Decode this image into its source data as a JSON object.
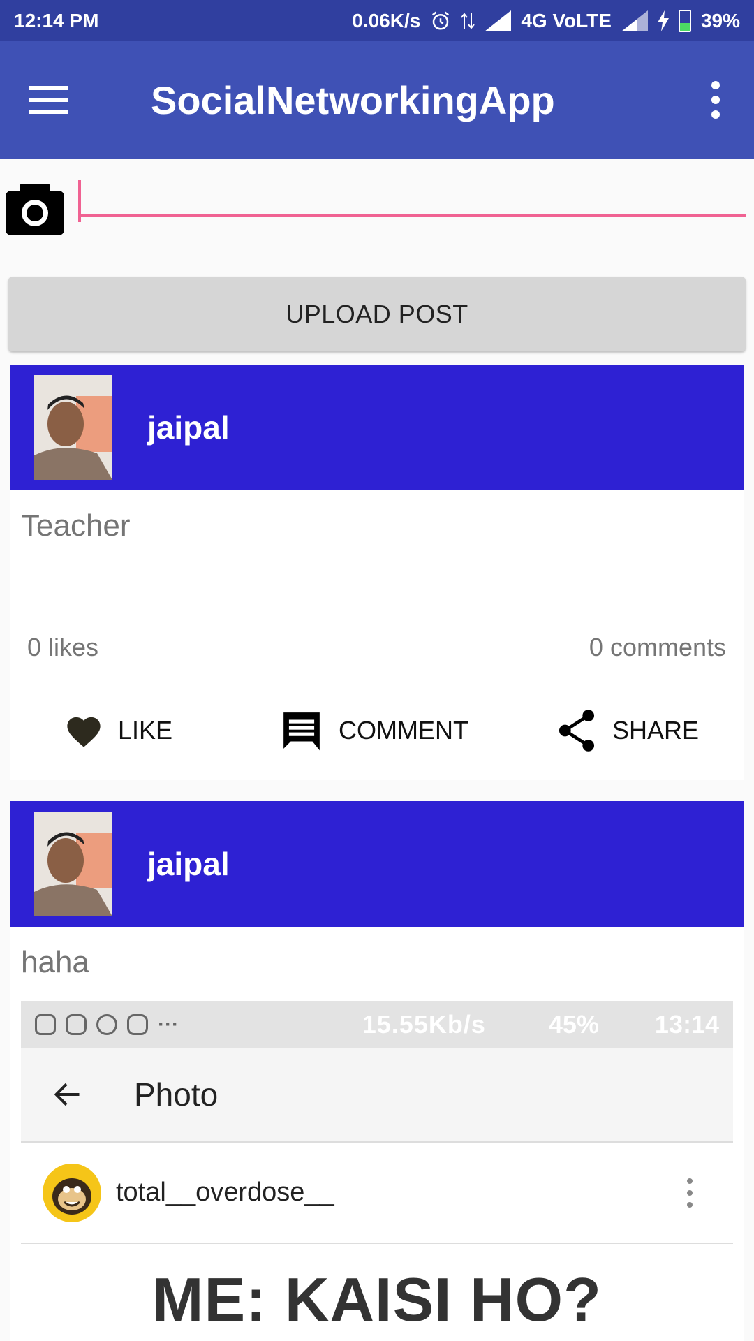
{
  "status_bar": {
    "time": "12:14 PM",
    "speed": "0.06K/s",
    "network": "4G VoLTE",
    "battery": "39%",
    "icons": [
      "alarm-icon",
      "data-arrows-icon",
      "signal-icon",
      "charging-icon",
      "battery-icon"
    ]
  },
  "app_bar": {
    "title": "SocialNetworkingApp",
    "background": "#3f51b5",
    "status_background": "#303f9f"
  },
  "compose": {
    "input_value": "",
    "accent_color": "#f06292",
    "upload_label": "UPLOAD POST"
  },
  "posts": [
    {
      "author": "jaipal",
      "text": "Teacher",
      "likes": "0 likes",
      "comments": "0 comments",
      "actions": {
        "like": "LIKE",
        "comment": "COMMENT",
        "share": "SHARE"
      }
    },
    {
      "author": "jaipal",
      "text": "haha",
      "image": {
        "status_speed": "15.55Kb/s",
        "status_battery": "45%",
        "status_time": "13:14",
        "title": "Photo",
        "username": "total__overdose__",
        "meme_text": "ME: KAISI HO?"
      }
    }
  ],
  "colors": {
    "post_header": "#2e21d3"
  }
}
